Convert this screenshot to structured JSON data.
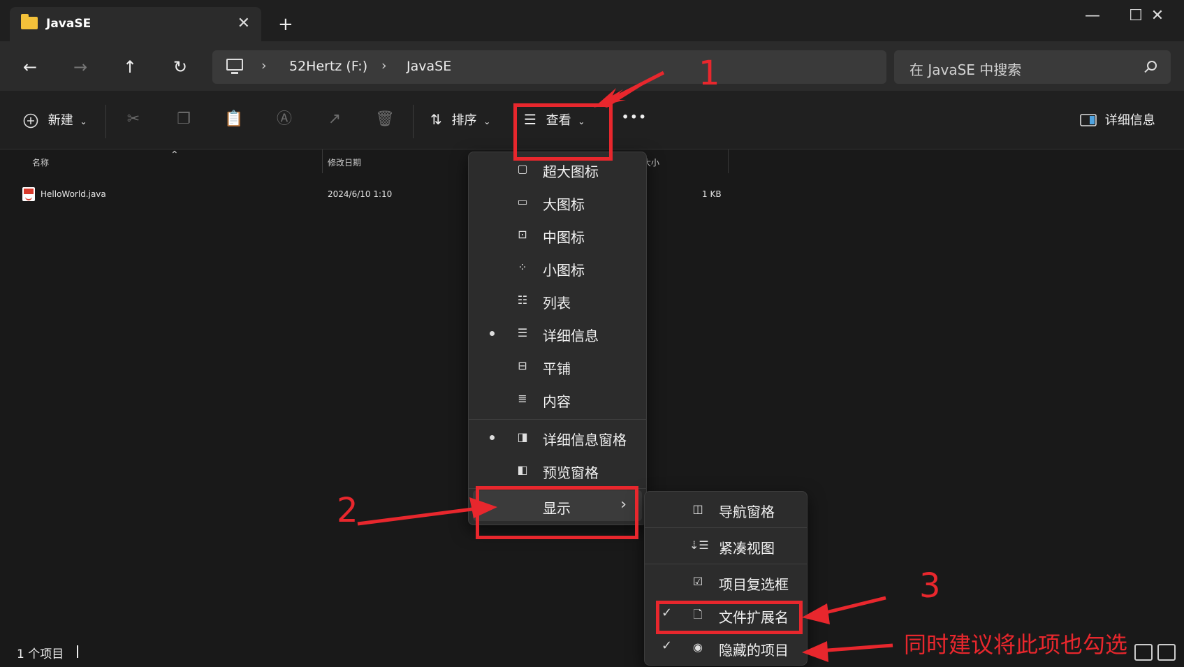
{
  "tab": {
    "title": "JavaSE",
    "close": "✕",
    "new_tab": "+"
  },
  "window_controls": {
    "minimize": "—",
    "maximize": "☐",
    "close": "✕"
  },
  "nav": {
    "back": "←",
    "forward": "→",
    "up": "↑",
    "refresh": "↻",
    "breadcrumb": [
      "52Hertz (F:)",
      "JavaSE"
    ],
    "breadcrumb_sep": "›",
    "search_placeholder": "在 JavaSE 中搜索"
  },
  "toolbar": {
    "new_label": "新建",
    "sort_label": "排序",
    "view_label": "查看",
    "more_label": "•••",
    "details_label": "详细信息"
  },
  "columns": {
    "name": "名称",
    "modified": "修改日期",
    "size": "大小"
  },
  "files": [
    {
      "name": "HelloWorld.java",
      "modified": "2024/6/10 1:10",
      "size": "1 KB"
    }
  ],
  "view_menu": {
    "items": [
      {
        "label": "超大图标",
        "icon": "extra-large-icons-icon",
        "selected": false
      },
      {
        "label": "大图标",
        "icon": "large-icons-icon",
        "selected": false
      },
      {
        "label": "中图标",
        "icon": "medium-icons-icon",
        "selected": false
      },
      {
        "label": "小图标",
        "icon": "small-icons-icon",
        "selected": false
      },
      {
        "label": "列表",
        "icon": "list-icon",
        "selected": false
      },
      {
        "label": "详细信息",
        "icon": "details-icon",
        "selected": true
      },
      {
        "label": "平铺",
        "icon": "tiles-icon",
        "selected": false
      },
      {
        "label": "内容",
        "icon": "content-icon",
        "selected": false
      }
    ],
    "panes": [
      {
        "label": "详细信息窗格",
        "icon": "details-pane-icon",
        "selected": true
      },
      {
        "label": "预览窗格",
        "icon": "preview-pane-icon",
        "selected": false
      }
    ],
    "show_label": "显示",
    "show_chevron": "›"
  },
  "show_submenu": {
    "items": [
      {
        "label": "导航窗格",
        "icon": "navigation-pane-icon",
        "checked": false
      },
      {
        "label": "紧凑视图",
        "icon": "compact-view-icon",
        "checked": false
      },
      {
        "label": "项目复选框",
        "icon": "item-checkboxes-icon",
        "checked": false
      },
      {
        "label": "文件扩展名",
        "icon": "file-extension-icon",
        "checked": true
      },
      {
        "label": "隐藏的项目",
        "icon": "hidden-items-icon",
        "checked": true
      }
    ],
    "check_glyph": "✓"
  },
  "status": {
    "item_count": "1 个项目"
  },
  "annotations": {
    "step1": "1",
    "step2": "2",
    "step3": "3",
    "note": "同时建议将此项也勾选",
    "color": "#e8272d"
  }
}
